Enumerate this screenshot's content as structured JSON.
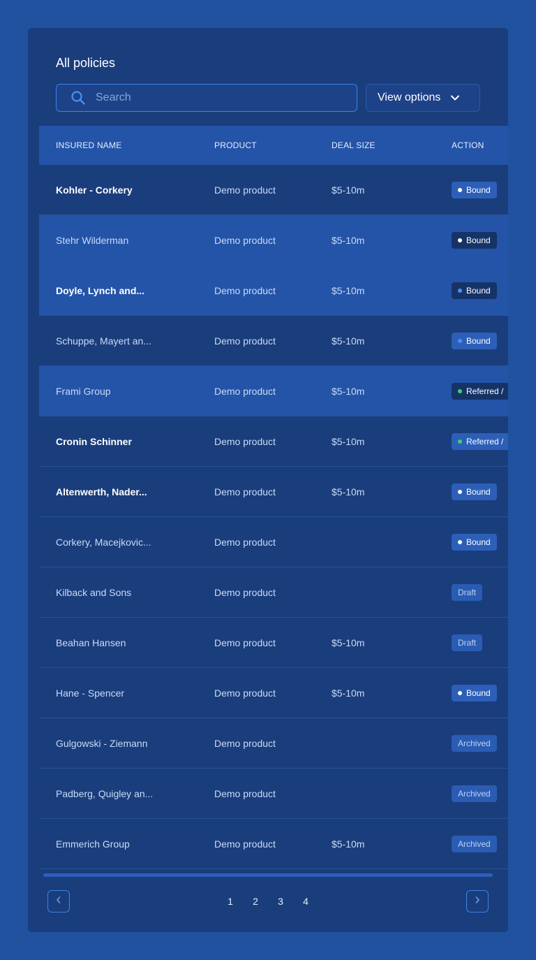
{
  "header": {
    "title": "All policies",
    "search_placeholder": "Search",
    "view_options_label": "View options"
  },
  "table": {
    "columns": [
      "INSURED NAME",
      "PRODUCT",
      "DEAL SIZE",
      "ACTION"
    ],
    "rows": [
      {
        "name": "Kohler - Corkery",
        "product": "Demo product",
        "deal": "$5-10m",
        "action": "Bound"
      },
      {
        "name": "Stehr Wilderman",
        "product": "Demo product",
        "deal": "$5-10m",
        "action": "Bound"
      },
      {
        "name": "Doyle, Lynch and...",
        "product": "Demo product",
        "deal": "$5-10m",
        "action": "Bound"
      },
      {
        "name": "Schuppe, Mayert an...",
        "product": "Demo product",
        "deal": "$5-10m",
        "action": "Bound"
      },
      {
        "name": "Frami Group",
        "product": "Demo product",
        "deal": "$5-10m",
        "action": "Referred /"
      },
      {
        "name": "Cronin Schinner",
        "product": "Demo product",
        "deal": "$5-10m",
        "action": "Referred /"
      },
      {
        "name": "Altenwerth, Nader...",
        "product": "Demo product",
        "deal": "$5-10m",
        "action": "Bound"
      },
      {
        "name": "Corkery, Macejkovic...",
        "product": "Demo product",
        "deal": "",
        "action": "Bound"
      },
      {
        "name": "Kilback and Sons",
        "product": "Demo product",
        "deal": "",
        "action": "Draft"
      },
      {
        "name": "Beahan Hansen",
        "product": "Demo product",
        "deal": "$5-10m",
        "action": "Draft"
      },
      {
        "name": "Hane - Spencer",
        "product": "Demo product",
        "deal": "$5-10m",
        "action": "Bound"
      },
      {
        "name": "Gulgowski - Ziemann",
        "product": "Demo product",
        "deal": "",
        "action": "Archived"
      },
      {
        "name": "Padberg, Quigley an...",
        "product": "Demo product",
        "deal": "",
        "action": "Archived"
      },
      {
        "name": "Emmerich Group",
        "product": "Demo product",
        "deal": "$5-10m",
        "action": "Archived"
      }
    ]
  },
  "pagination": {
    "pages": [
      "1",
      "2",
      "3",
      "4"
    ],
    "prev_icon": "chevron-left-icon",
    "next_icon": "chevron-right-icon"
  },
  "colors": {
    "background": "#2152a0",
    "card": "#1a3d7c",
    "accent": "#3d83e8",
    "dot_white": "#ffffff",
    "dot_blue": "#4a90f0",
    "dot_green": "#3ecf6e"
  }
}
